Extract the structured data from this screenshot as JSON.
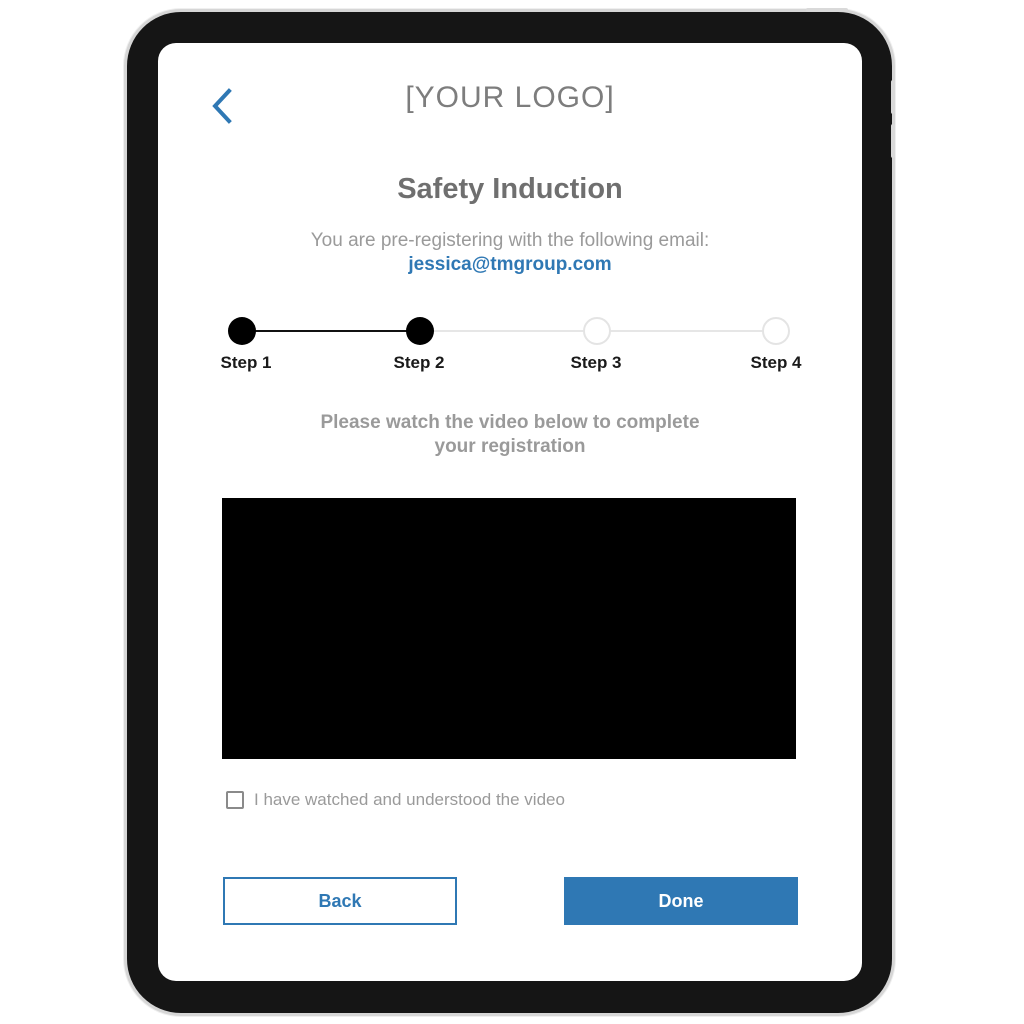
{
  "header": {
    "logo_text": "[YOUR LOGO]",
    "back_icon": "chevron-left-icon"
  },
  "page": {
    "title": "Safety Induction",
    "subtitle": "You are pre-registering with the following email:",
    "email": "jessica@tmgroup.com"
  },
  "stepper": {
    "current_step": 2,
    "steps": [
      {
        "label": "Step 1",
        "complete": true
      },
      {
        "label": "Step 2",
        "complete": true
      },
      {
        "label": "Step 3",
        "complete": false
      },
      {
        "label": "Step 4",
        "complete": false
      }
    ]
  },
  "content": {
    "instructions_line1": "Please watch the video below to complete",
    "instructions_line2": "your registration",
    "checkbox_label": "I have watched and understood the video",
    "checkbox_checked": false
  },
  "actions": {
    "back_label": "Back",
    "done_label": "Done"
  },
  "colors": {
    "accent": "#2f78b4",
    "step_active": "#000000",
    "step_inactive": "#e4e4e4",
    "video_background": "#000000"
  }
}
